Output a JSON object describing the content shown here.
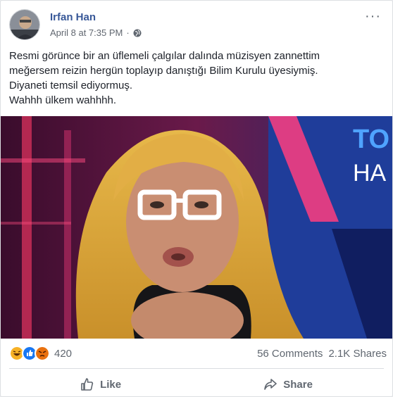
{
  "post": {
    "author": "Irfan Han",
    "date": "April 8 at 7:35 PM",
    "separator": "·",
    "privacy_icon": "globe-icon",
    "text_lines": [
      "Resmi görünce bir an üflemeli çalgılar dalında müzisyen zannettim",
      "meğersem reizin hergün toplayıp danıştığı Bilim Kurulu üyesiymiş.",
      "Diyaneti temsil ediyormuş.",
      "Wahhh ülkem wahhhh."
    ],
    "image_overlay_text": [
      "TO",
      "HA"
    ]
  },
  "stats": {
    "reaction_icons": [
      "haha-icon",
      "like-icon",
      "angry-icon"
    ],
    "reaction_count": "420",
    "comments": "56 Comments",
    "shares": "2.1K Shares"
  },
  "actions": {
    "like_label": "Like",
    "share_label": "Share"
  },
  "colors": {
    "author_link": "#385898",
    "text": "#1d2129",
    "muted": "#606770",
    "like_blue": "#1877f2",
    "haha_yellow": "#f7b125",
    "angry_orange": "#e9710f"
  }
}
